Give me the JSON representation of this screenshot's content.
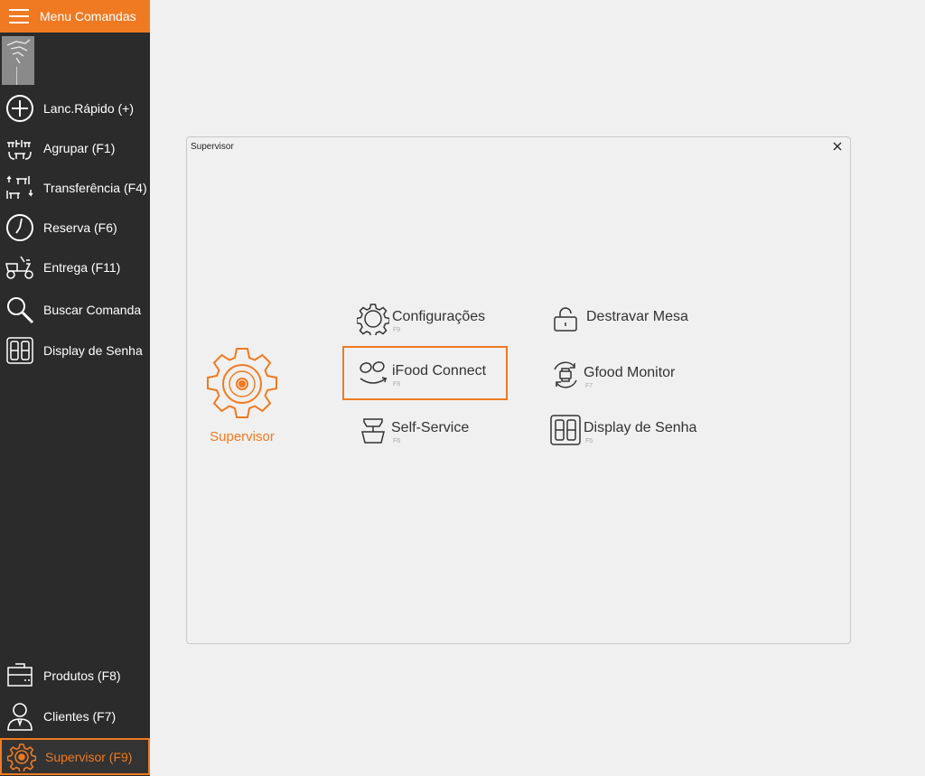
{
  "sidebar": {
    "title": "Menu Comandas",
    "items": [
      {
        "label": "Lanc.Rápido (+)",
        "icon": "plus-circle-icon"
      },
      {
        "label": "Agrupar (F1)",
        "icon": "group-tables-icon"
      },
      {
        "label": "Transferência (F4)",
        "icon": "transfer-tables-icon"
      },
      {
        "label": "Reserva (F6)",
        "icon": "clock-icon"
      },
      {
        "label": "Entrega (F11)",
        "icon": "scooter-icon"
      },
      {
        "label": "Buscar Comanda",
        "icon": "magnifier-icon"
      },
      {
        "label": "Display de Senha",
        "icon": "digital-display-icon"
      }
    ],
    "bottom_items": [
      {
        "label": "Produtos (F8)",
        "icon": "products-box-icon"
      },
      {
        "label": "Clientes (F7)",
        "icon": "person-icon"
      },
      {
        "label": "Supervisor (F9)",
        "icon": "gear-icon",
        "active": true
      }
    ]
  },
  "dialog": {
    "title": "Supervisor",
    "heading": "Supervisor",
    "tiles": [
      {
        "label": "Configurações",
        "key": "F9",
        "icon": "gear-icon"
      },
      {
        "label": "Destravar Mesa",
        "key": "",
        "icon": "unlock-icon"
      },
      {
        "label": "iFood Connect",
        "key": "F8",
        "icon": "ifood-icon",
        "selected": true
      },
      {
        "label": "Gfood Monitor",
        "key": "F7",
        "icon": "printer-sync-icon"
      },
      {
        "label": "Self-Service",
        "key": "F6",
        "icon": "scale-icon"
      },
      {
        "label": "Display de Senha",
        "key": "F5",
        "icon": "digital-display-icon"
      }
    ]
  },
  "colors": {
    "accent": "#ef7a21",
    "sidebar_bg": "#2b2b2b",
    "background": "#f0f0f0"
  }
}
